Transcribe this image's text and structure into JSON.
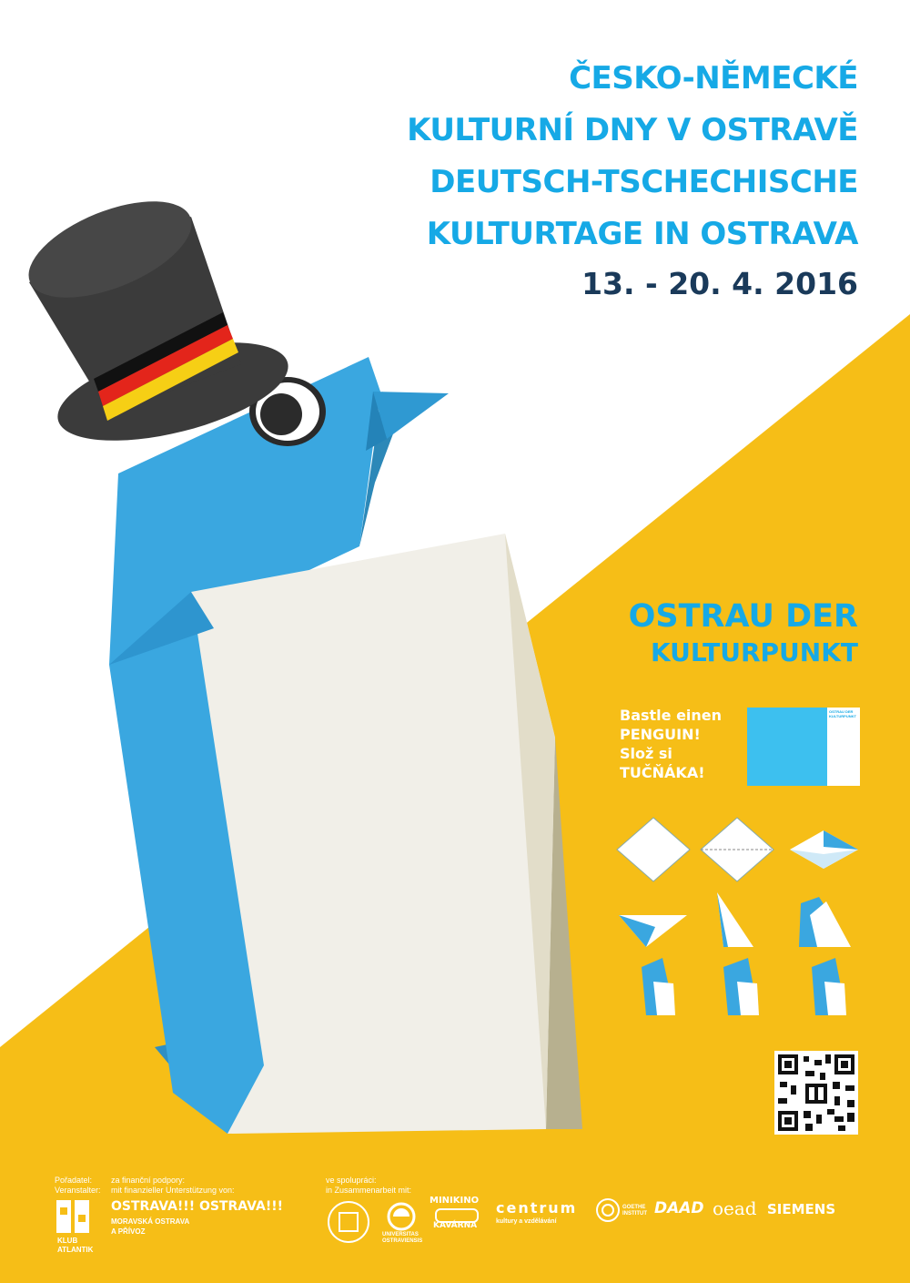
{
  "colors": {
    "yellow": "#f6be17",
    "title_blue": "#16a9e6",
    "date_navy": "#1a3a5a",
    "penguin_blue": "#3aa7e0",
    "hat": "#3b3b3b"
  },
  "title": {
    "line1": "ČESKO-NĚMECKÉ",
    "line2": "KULTURNÍ DNY V OSTRAVĚ",
    "line3": "DEUTSCH-TSCHECHISCHE",
    "line4": "KULTURTAGE IN OSTRAVA",
    "date": "13. - 20. 4. 2016"
  },
  "motto": {
    "line1": "OSTRAU DER",
    "line2": "KULTURPUNKT"
  },
  "craft": {
    "line1": "Bastle einen",
    "line2": "PENGUIN!",
    "line3": "Slož si",
    "line4": "TUČŇÁKA!",
    "mini_title": "OSTRAU DER KULTURPUNKT"
  },
  "icons": {
    "mascot": "origami-penguin-icon",
    "hat": "top-hat-icon",
    "qr": "qr-code-icon"
  },
  "footer": {
    "organizer_label_cz": "Pořadatel:",
    "organizer_label_de": "Veranstalter:",
    "klub_atlantik": "KLUB ATLANTIK",
    "support_label_cz": "za finanční podpory:",
    "support_label_de": "mit finanzieller Unterstützung von:",
    "ostrava": "OSTRAVA!!! OSTRAVA!!!",
    "moravska": "MORAVSKÁ OSTRAVA",
    "privoz": "A PŘÍVOZ",
    "coop_label_cz": "ve spolupráci:",
    "coop_label_de": "in Zusammenarbeit mit:",
    "universitas": "UNIVERSITAS OSTRAVIENSIS",
    "minikino": "MINIKINO",
    "kavarna": "KAVÁRNA",
    "centrum": "centrum",
    "centrum_sub": "kultury a vzdělávání",
    "goethe": "GOETHE INSTITUT",
    "daad": "DAAD",
    "oead": "oead",
    "siemens": "SIEMENS"
  }
}
